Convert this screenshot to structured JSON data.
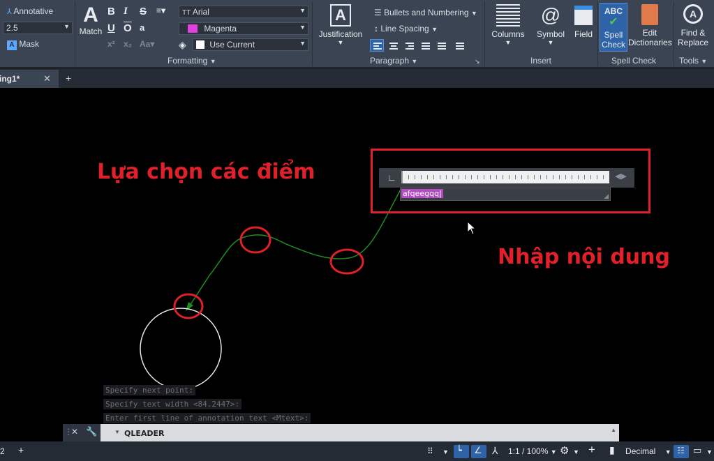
{
  "ribbon": {
    "style": {
      "annotative_label": "Annotative",
      "text_height_value": "2.5",
      "mask_label": "Mask"
    },
    "match": {
      "label": "Match"
    },
    "formatting": {
      "font_value": "Arial",
      "color_value": "Magenta",
      "color_swatch": "#e040e0",
      "background_value": "Use Current",
      "panel_title": "Formatting"
    },
    "justification": {
      "label": "Justification"
    },
    "paragraph": {
      "bullets_label": "Bullets and Numbering",
      "line_spacing_label": "Line Spacing",
      "panel_title": "Paragraph"
    },
    "insert": {
      "columns_label": "Columns",
      "symbol_label": "Symbol",
      "field_label": "Field",
      "panel_title": "Insert"
    },
    "spell": {
      "spell_check_line1": "Spell",
      "spell_check_line2": "Check",
      "spell_icon_text": "ABC",
      "edit_dict_line1": "Edit",
      "edit_dict_line2": "Dictionaries",
      "panel_title": "Spell Check"
    },
    "tools": {
      "find_line1": "Find &",
      "find_line2": "Replace",
      "panel_title": "Tools"
    }
  },
  "tabs": {
    "active_tab_label": "ing1*"
  },
  "canvas": {
    "annotation_select_points": "Lựa chọn các điểm",
    "annotation_enter_content": "Nhập nội dung",
    "typed_text": "afqeegqq|",
    "accent_red": "#e0202a",
    "leader_color": "#1f8c1f"
  },
  "command_history": [
    "Specify next point:",
    "Specify text width <84.2447>:",
    "Enter first line of annotation text <Mtext>:"
  ],
  "command_line": {
    "current_command": "QLEADER"
  },
  "statusbar": {
    "left_tab": "2",
    "scale": "1:1 / 100%",
    "units": "Decimal"
  }
}
